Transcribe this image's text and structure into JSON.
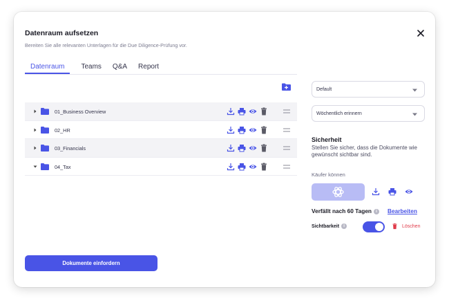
{
  "dialog": {
    "title": "Datenraum aufsetzen",
    "subtitle": "Bereiten Sie alle relevanten Unterlagen für die Due Diligence-Prüfung vor.",
    "close_icon": "close-icon"
  },
  "tabs": [
    {
      "label": "Datenraum",
      "active": true
    },
    {
      "label": "Teams",
      "active": false
    },
    {
      "label": "Q&A",
      "active": false
    },
    {
      "label": "Report",
      "active": false
    }
  ],
  "folders": [
    {
      "name": "01_Business Overview",
      "expanded": false
    },
    {
      "name": "02_HR",
      "expanded": false
    },
    {
      "name": "03_Financials",
      "expanded": false
    },
    {
      "name": "04_Tax",
      "expanded": true
    }
  ],
  "row_icons": [
    "download-icon",
    "print-icon",
    "eye-icon",
    "trash-icon",
    "drag-handle-icon"
  ],
  "settings": {
    "template_select": "Default",
    "reminder_select": "Wöchentlich erinnern"
  },
  "security": {
    "title": "Sicherheit",
    "text": "Stellen Sie sicher, dass die Dokumente wie gewünscht sichtbar sind.",
    "buyers_label": "Käufer können",
    "expiry": "Verfällt nach 60 Tagen",
    "edit_label": "Bearbeiten",
    "visibility_label": "Sichtbarkeit",
    "visibility_on": true,
    "delete_label": "Löschen"
  },
  "actions": {
    "request_documents": "Dokumente einfordern"
  },
  "colors": {
    "accent": "#4954e6",
    "accent_light": "#b8bcf5",
    "danger": "#e03b4a"
  }
}
